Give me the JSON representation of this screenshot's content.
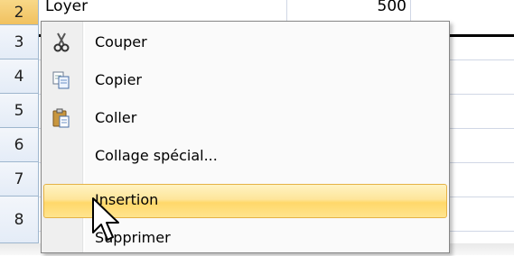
{
  "spreadsheet": {
    "rows": [
      {
        "num": "2",
        "label": "Loyer",
        "value": "500",
        "selected": true
      },
      {
        "num": "3",
        "selected": false
      },
      {
        "num": "4",
        "selected": false
      },
      {
        "num": "5",
        "selected": false
      },
      {
        "num": "6",
        "selected": false
      },
      {
        "num": "7",
        "selected": false
      },
      {
        "num": "8",
        "selected": false
      }
    ]
  },
  "context_menu": {
    "items": [
      {
        "label": "Couper",
        "icon": "scissors-icon",
        "highlighted": false
      },
      {
        "label": "Copier",
        "icon": "copy-icon",
        "highlighted": false
      },
      {
        "label": "Coller",
        "icon": "paste-icon",
        "highlighted": false
      },
      {
        "label": "Collage spécial...",
        "icon": "",
        "highlighted": false
      },
      {
        "label": "Insertion",
        "icon": "",
        "highlighted": true
      },
      {
        "label": "Supprimer",
        "icon": "",
        "highlighted": false
      }
    ]
  },
  "colors": {
    "menu_highlight": "#ffd86a",
    "highlight_border": "#e5b246",
    "row_header_selected": "#f1c15f"
  }
}
